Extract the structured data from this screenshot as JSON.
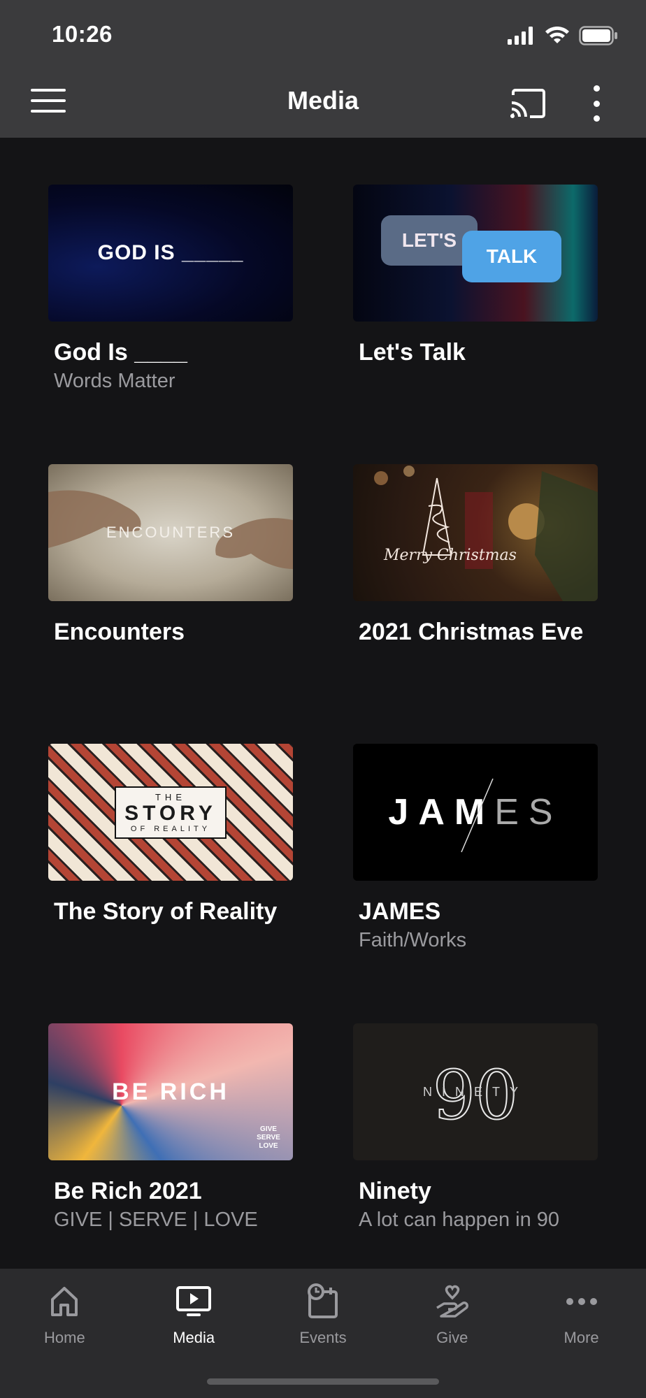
{
  "status_bar": {
    "time": "10:26"
  },
  "app_bar": {
    "title": "Media",
    "menu_icon": "hamburger-menu-icon",
    "cast_icon": "cast-icon",
    "more_icon": "more-vertical-icon"
  },
  "media_items": [
    {
      "title": "God Is ____",
      "subtitle": "Words Matter",
      "thumb_text": "GOD IS _____"
    },
    {
      "title": "Let's Talk",
      "subtitle": "",
      "thumb_text_1": "LET'S",
      "thumb_text_2": "TALK"
    },
    {
      "title": "Encounters",
      "subtitle": "",
      "thumb_text": "ENCOUNTERS"
    },
    {
      "title": "2021 Christmas Eve",
      "subtitle": "",
      "thumb_text": "Merry Christmas"
    },
    {
      "title": "The Story of Reality",
      "subtitle": "",
      "thumb_text_1": "THE",
      "thumb_text_2": "STORY",
      "thumb_text_3": "OF REALITY"
    },
    {
      "title": "JAMES",
      "subtitle": "Faith/Works",
      "thumb_text_1": "JAM",
      "thumb_text_2": "ES"
    },
    {
      "title": "Be Rich 2021",
      "subtitle": "GIVE | SERVE | LOVE",
      "thumb_text": "BE RICH",
      "thumb_small": "GIVE SERVE LOVE"
    },
    {
      "title": "Ninety",
      "subtitle": "A lot can happen in 90",
      "thumb_text": "NINETY",
      "thumb_num": "90"
    }
  ],
  "bottom_nav": [
    {
      "label": "Home",
      "icon": "home-icon",
      "active": false
    },
    {
      "label": "Media",
      "icon": "tv-play-icon",
      "active": true
    },
    {
      "label": "Events",
      "icon": "calendar-clock-icon",
      "active": false
    },
    {
      "label": "Give",
      "icon": "hand-heart-icon",
      "active": false
    },
    {
      "label": "More",
      "icon": "more-horizontal-icon",
      "active": false
    }
  ]
}
